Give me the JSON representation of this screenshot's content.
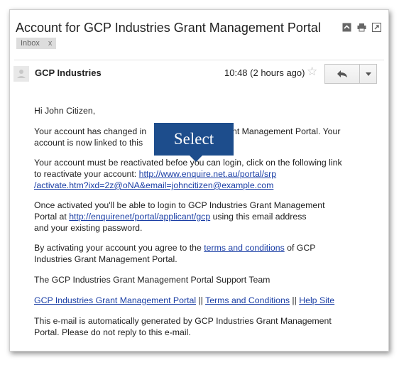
{
  "email": {
    "subject": "Account for GCP Industries Grant Management Portal",
    "label": "Inbox",
    "label_close": "x",
    "sender": "GCP Industries",
    "time": "10:48 (2 hours ago)",
    "star": "☆"
  },
  "body": {
    "greeting": "Hi John Citizen,",
    "p1_a": "Your account has changed in",
    "p1_b": "ant Management Portal. Your",
    "p1_c": "account is now linked to this",
    "p2_a": "Your account must be reactivated befo",
    "p2_b": "e you can login, click on the following link",
    "p2_c": "to reactivate your account: ",
    "p2_link1": "http://www.enquire.net.au/portal/srp",
    "p2_link2": "/activate.htm?ixd=2z@oNA&email=johncitizen@example.com",
    "p3_a": "Once activated you'll be able to login to GCP Industries Grant Management",
    "p3_b": "Portal at ",
    "p3_link": "http://enquirenet/portal/applicant/gcp",
    "p3_c": " using this email address",
    "p3_d": "and your existing password.",
    "p4_a": "By activating your account you agree to the ",
    "p4_link": "terms and conditions",
    "p4_b": " of GCP",
    "p4_c": "Industries Grant Management Portal.",
    "signature": "The GCP Industries Grant Management Portal Support Team",
    "footer_link1": "GCP Industries Grant Management Portal",
    "sep": " || ",
    "footer_link2": "Terms and Conditions",
    "footer_link3": "Help Site",
    "disclaimer_a": "This e-mail is automatically generated by GCP Industries Grant Management",
    "disclaimer_b": "Portal. Please do not reply to this e-mail."
  },
  "tooltip": {
    "label": "Select"
  }
}
